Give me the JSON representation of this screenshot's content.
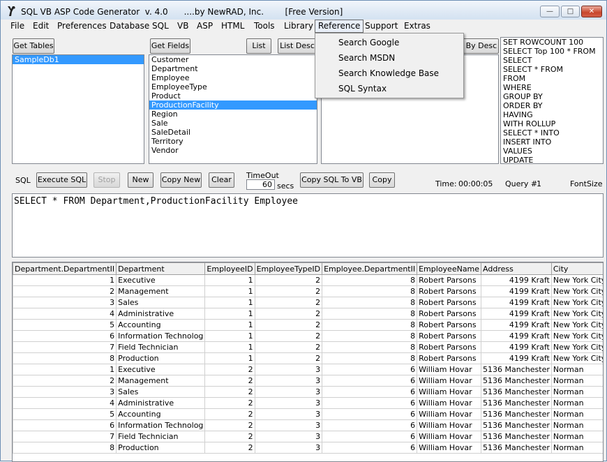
{
  "window": {
    "title": "SQL VB ASP Code Generator  v. 4.0      ....by NewRAD, Inc.        [Free Version]",
    "minimize": "—",
    "maximize": "□",
    "close": "✕"
  },
  "menu": [
    "File",
    "Edit",
    "Preferences",
    "Database",
    "SQL",
    "VB",
    "ASP",
    "HTML",
    "Tools",
    "Library",
    "Reference",
    "Support",
    "Extras"
  ],
  "reference_menu": {
    "items": [
      "Search Google",
      "Search MSDN",
      "Search Knowledge Base",
      "SQL Syntax"
    ]
  },
  "tables_panel": {
    "get_tables_label": "Get Tables",
    "items": [
      "SampleDb1"
    ],
    "selected": "SampleDb1"
  },
  "fields_panel": {
    "get_fields_label": "Get Fields",
    "list_label": "List",
    "list_desc_label": "List Desc",
    "sort_desc_label": "t By Desc",
    "items": [
      "Customer",
      "Department",
      "Employee",
      "EmployeeType",
      "Product",
      "ProductionFacility",
      "Region",
      "Sale",
      "SaleDetail",
      "Territory",
      "Vendor"
    ],
    "selected": "ProductionFacility"
  },
  "keywords_panel": {
    "items": [
      "SET ROWCOUNT 100",
      "SELECT Top 100 * FROM",
      "SELECT",
      "SELECT * FROM",
      "FROM",
      "WHERE",
      "GROUP BY",
      "ORDER BY",
      "HAVING",
      "WITH ROLLUP",
      "SELECT * INTO",
      "INSERT INTO",
      "VALUES",
      "UPDATE"
    ]
  },
  "toolbar": {
    "sql_label": "SQL",
    "execute_label": "Execute SQL",
    "stop_label": "Stop",
    "new_label": "New",
    "copy_new_label": "Copy New",
    "clear_label": "Clear",
    "timeout_label": "TimeOut",
    "timeout_value": "60",
    "timeout_unit": "secs",
    "copy_sql_vb_label": "Copy SQL To VB",
    "copy_label": "Copy",
    "time_label": "Time:",
    "time_value": "00:00:05",
    "query_label": "Query #",
    "query_value": "1",
    "fontsize_label": "FontSize"
  },
  "sql_text": "SELECT * FROM Department,ProductionFacility Employee",
  "results": {
    "columns": [
      "Department.DepartmentII",
      "Department",
      "EmployeeID",
      "EmployeeTypeID",
      "Employee.DepartmentII",
      "EmployeeName",
      "Address",
      "City"
    ],
    "rows": [
      [
        "1",
        "Executive",
        "1",
        "2",
        "8",
        "Robert Parsons",
        "4199 Kraft",
        "New York City"
      ],
      [
        "2",
        "Management",
        "1",
        "2",
        "8",
        "Robert Parsons",
        "4199 Kraft",
        "New York City"
      ],
      [
        "3",
        "Sales",
        "1",
        "2",
        "8",
        "Robert Parsons",
        "4199 Kraft",
        "New York City"
      ],
      [
        "4",
        "Administrative",
        "1",
        "2",
        "8",
        "Robert Parsons",
        "4199 Kraft",
        "New York City"
      ],
      [
        "5",
        "Accounting",
        "1",
        "2",
        "8",
        "Robert Parsons",
        "4199 Kraft",
        "New York City"
      ],
      [
        "6",
        "Information Technolog",
        "1",
        "2",
        "8",
        "Robert Parsons",
        "4199 Kraft",
        "New York City"
      ],
      [
        "7",
        "Field Technician",
        "1",
        "2",
        "8",
        "Robert Parsons",
        "4199 Kraft",
        "New York City"
      ],
      [
        "8",
        "Production",
        "1",
        "2",
        "8",
        "Robert Parsons",
        "4199 Kraft",
        "New York City"
      ],
      [
        "1",
        "Executive",
        "2",
        "3",
        "6",
        "William Hovar",
        "5136 Manchester",
        "Norman"
      ],
      [
        "2",
        "Management",
        "2",
        "3",
        "6",
        "William Hovar",
        "5136 Manchester",
        "Norman"
      ],
      [
        "3",
        "Sales",
        "2",
        "3",
        "6",
        "William Hovar",
        "5136 Manchester",
        "Norman"
      ],
      [
        "4",
        "Administrative",
        "2",
        "3",
        "6",
        "William Hovar",
        "5136 Manchester",
        "Norman"
      ],
      [
        "5",
        "Accounting",
        "2",
        "3",
        "6",
        "William Hovar",
        "5136 Manchester",
        "Norman"
      ],
      [
        "6",
        "Information Technolog",
        "2",
        "3",
        "6",
        "William Hovar",
        "5136 Manchester",
        "Norman"
      ],
      [
        "7",
        "Field Technician",
        "2",
        "3",
        "6",
        "William Hovar",
        "5136 Manchester",
        "Norman"
      ],
      [
        "8",
        "Production",
        "2",
        "3",
        "6",
        "William Hovar",
        "5136 Manchester",
        "Norman"
      ]
    ]
  }
}
